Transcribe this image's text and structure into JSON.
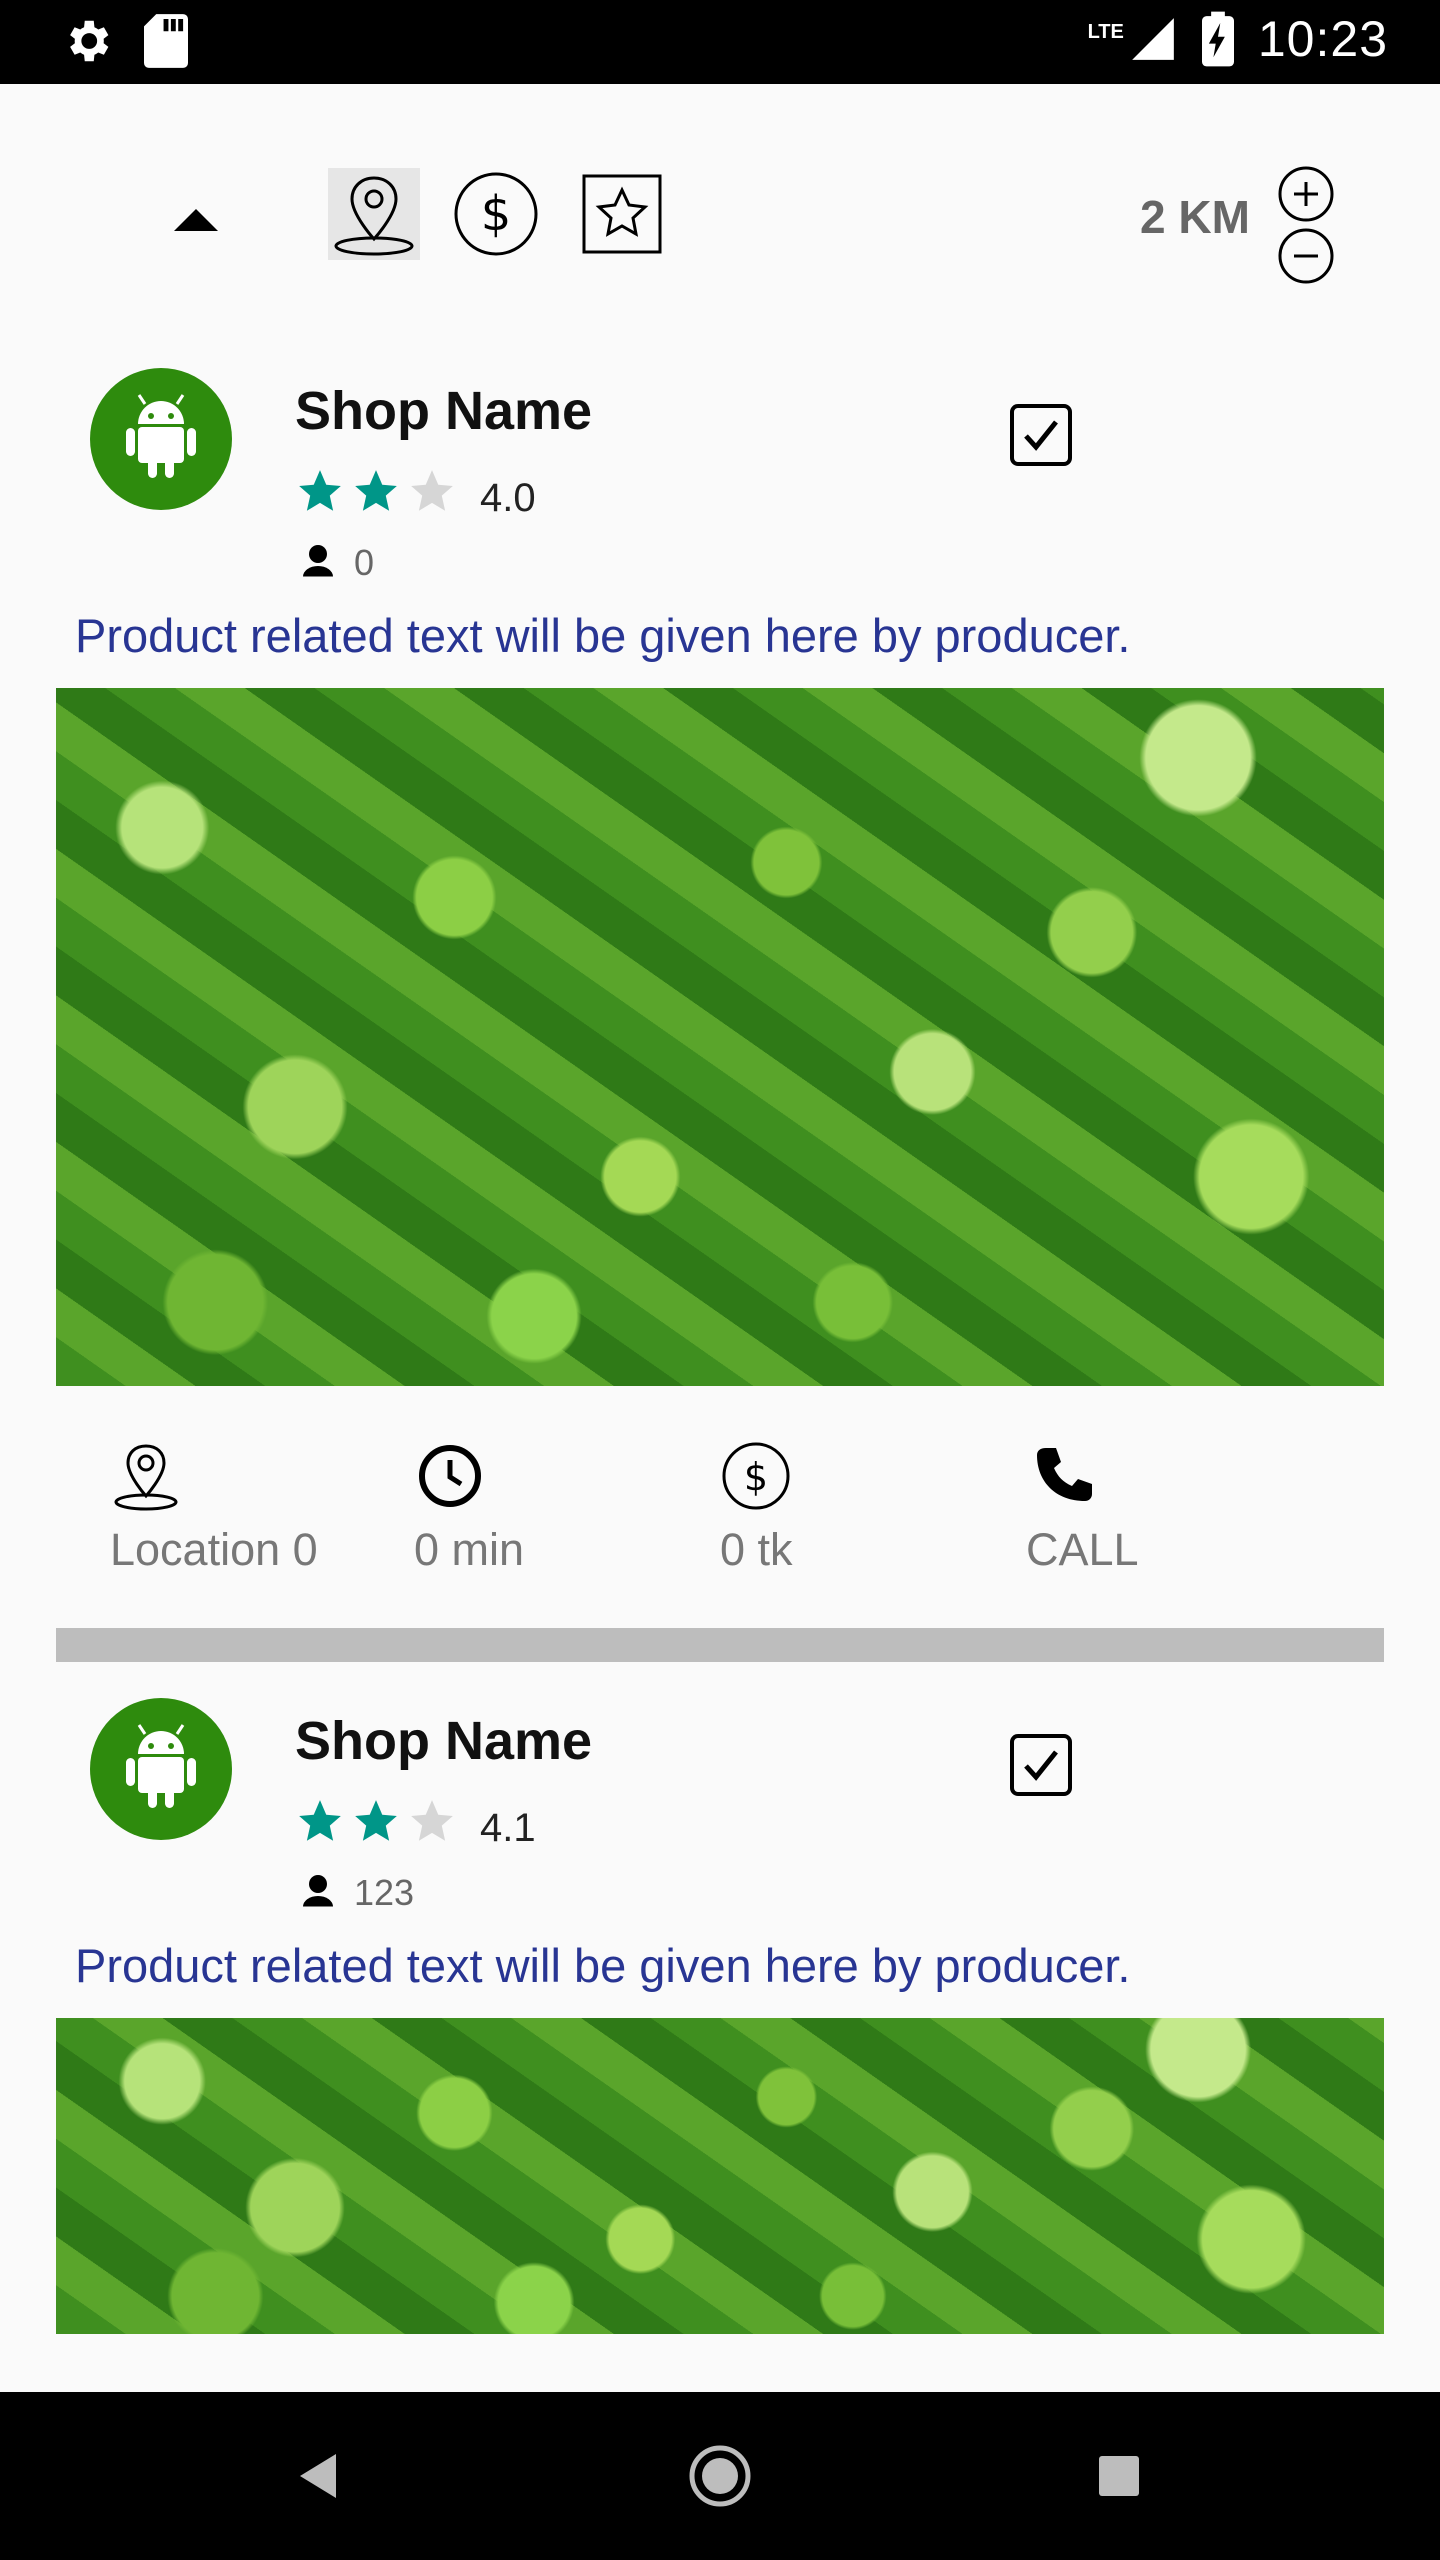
{
  "status_bar": {
    "time": "10:23",
    "network": "LTE"
  },
  "filter_bar": {
    "distance": "2 KM"
  },
  "cards": [
    {
      "shop_name": "Shop Name",
      "rating": "4.0",
      "stars_filled": 2,
      "stars_total": 3,
      "user_count": "0",
      "checked": true,
      "product_text": "Product related text will be given here by producer.",
      "info": {
        "location": "Location 0",
        "time": "0 min",
        "price": "0 tk",
        "call": "CALL"
      }
    },
    {
      "shop_name": "Shop Name",
      "rating": "4.1",
      "stars_filled": 2,
      "stars_total": 3,
      "user_count": "123",
      "checked": true,
      "product_text": "Product related text will be given here by producer."
    }
  ],
  "colors": {
    "accent_star": "#009688",
    "star_empty": "#d6d6d6",
    "product_text": "#283593",
    "avatar_bg": "#2e8b0d"
  }
}
